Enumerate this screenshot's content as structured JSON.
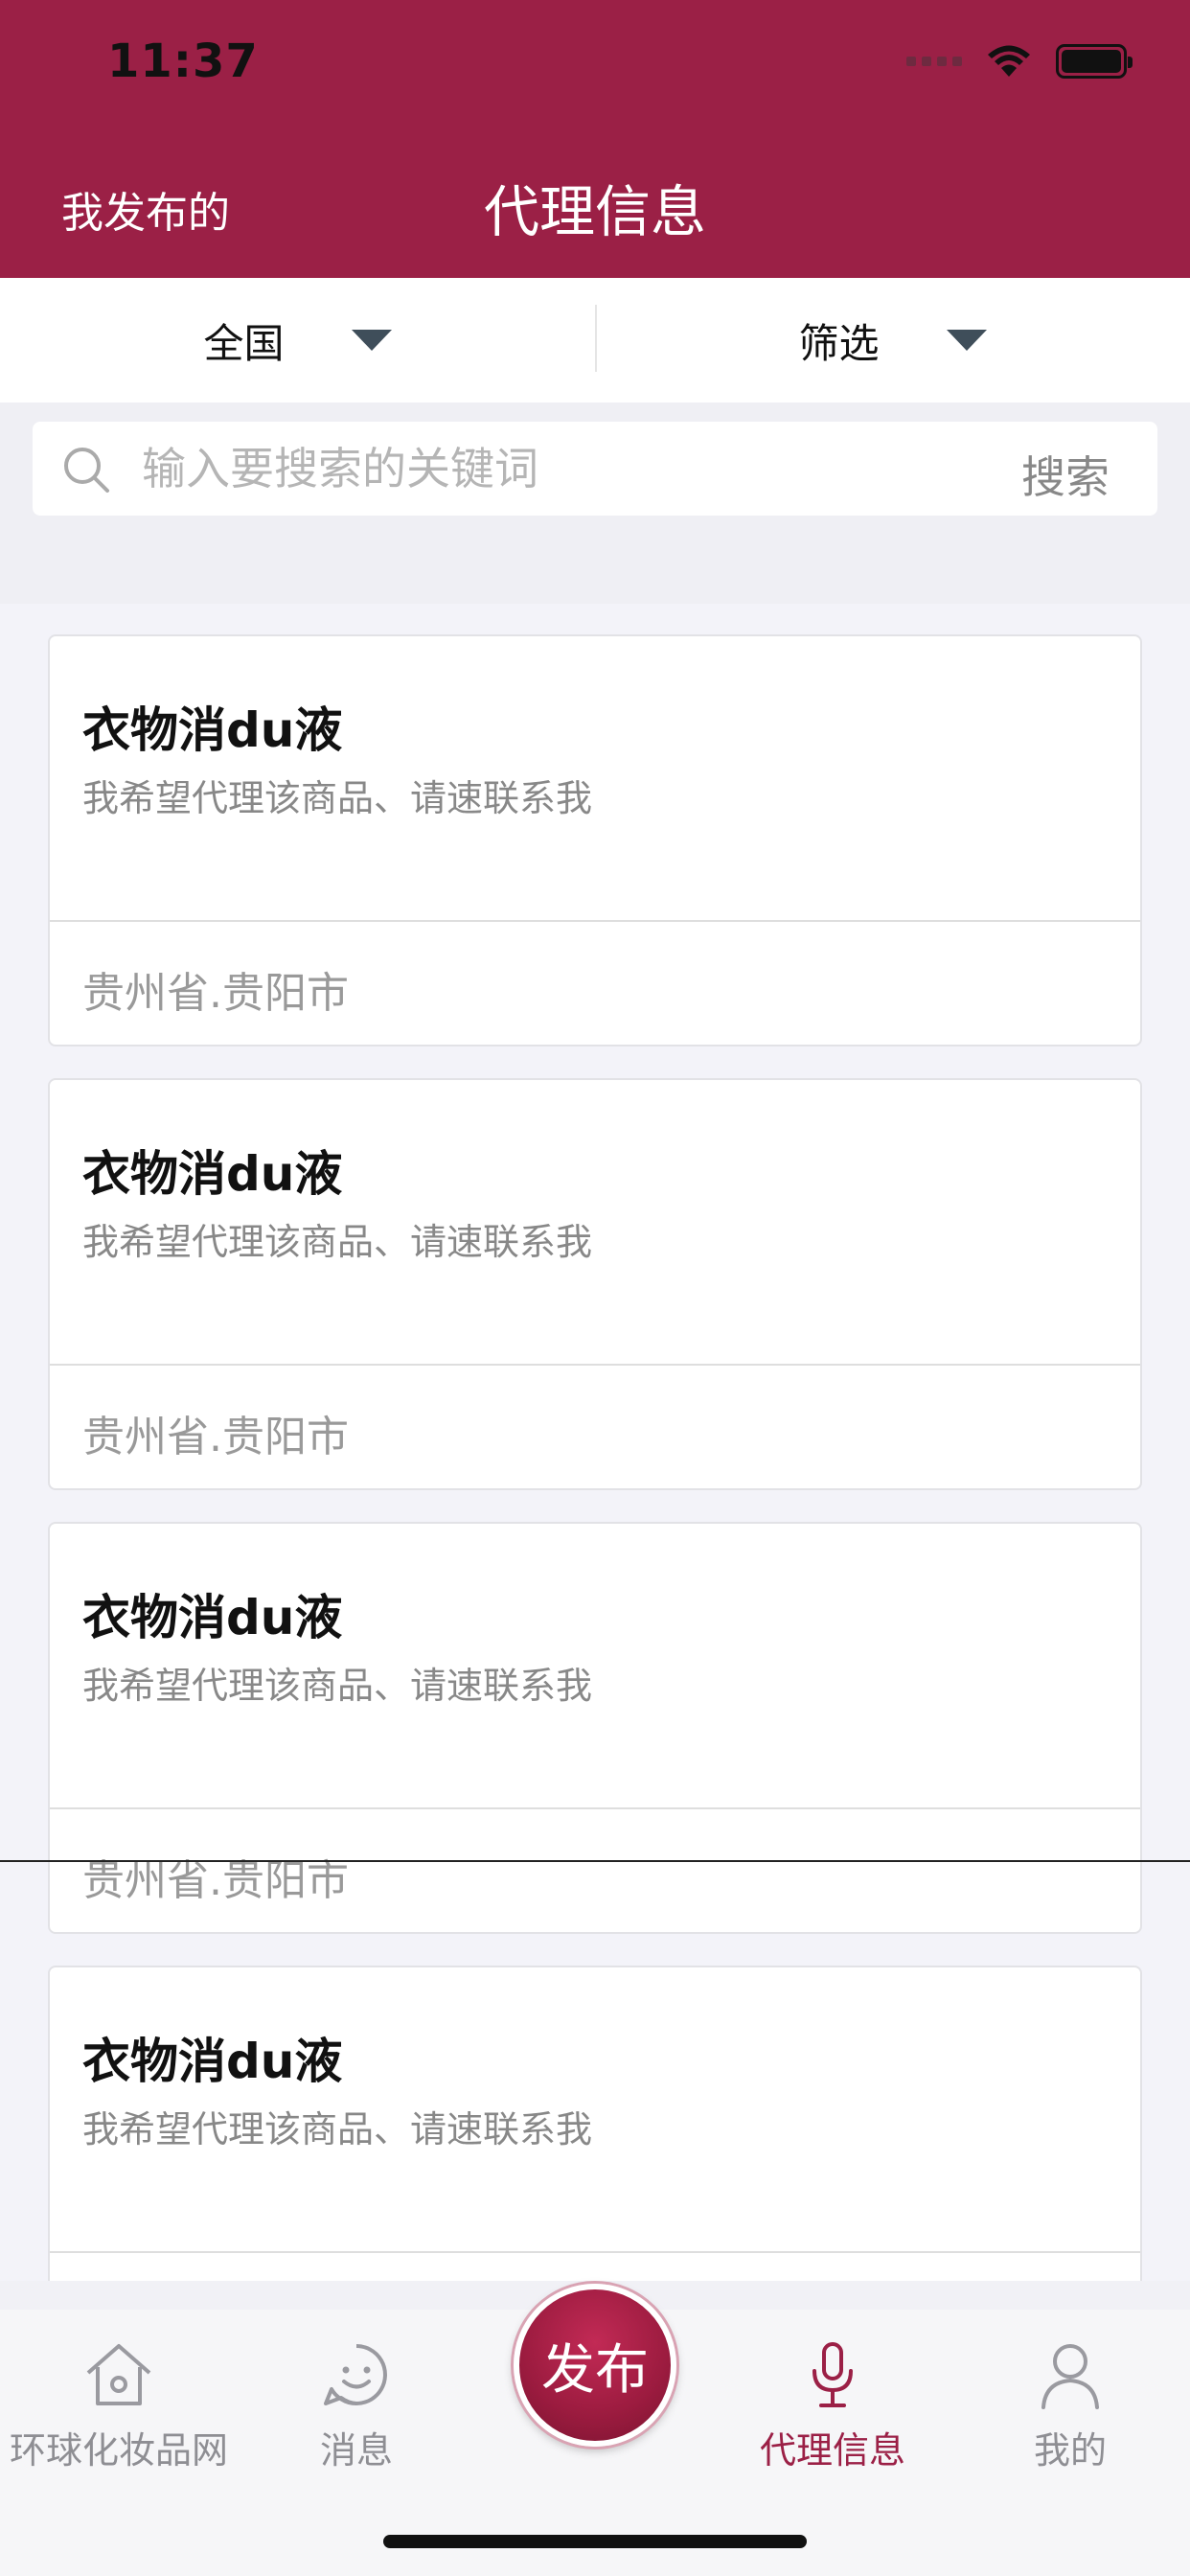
{
  "status_bar": {
    "time": "11:37"
  },
  "nav": {
    "left_label": "我发布的",
    "title": "代理信息"
  },
  "filters": {
    "region": "全国",
    "filter": "筛选"
  },
  "search": {
    "placeholder": "输入要搜索的关键词",
    "button": "搜索"
  },
  "items": [
    {
      "title": "衣物消du液",
      "desc": "我希望代理该商品、请速联系我",
      "location": "贵州省.贵阳市"
    },
    {
      "title": "衣物消du液",
      "desc": "我希望代理该商品、请速联系我",
      "location": "贵州省.贵阳市"
    },
    {
      "title": "衣物消du液",
      "desc": "我希望代理该商品、请速联系我",
      "location": "贵州省.贵阳市"
    },
    {
      "title": "衣物消du液",
      "desc": "我希望代理该商品、请速联系我",
      "location": ""
    }
  ],
  "tabs": [
    {
      "label": "环球化妆品网",
      "icon": "home-icon",
      "active": false
    },
    {
      "label": "消息",
      "icon": "smile-chat-icon",
      "active": false
    },
    {
      "label": "代理信息",
      "icon": "microphone-icon",
      "active": true
    },
    {
      "label": "我的",
      "icon": "person-icon",
      "active": false
    }
  ],
  "publish": {
    "label": "发布"
  },
  "colors": {
    "brand": "#9b2046",
    "inactive_tab": "#8e8e93"
  }
}
